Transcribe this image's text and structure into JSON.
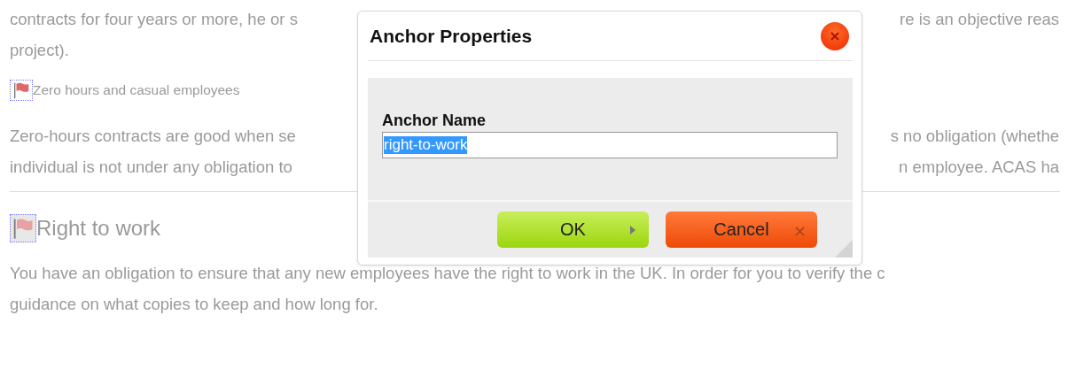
{
  "document": {
    "lines": [
      {
        "kind": "text",
        "left": "contracts for four years or more, he or s",
        "right": "re is an objective reas"
      },
      {
        "kind": "text",
        "left": "project)."
      },
      {
        "kind": "anchor",
        "left": "Zero hours and casual employees"
      },
      {
        "kind": "text",
        "left": "Zero-hours contracts are good when se",
        "right": "s no obligation (whethe"
      },
      {
        "kind": "text",
        "left": "individual is not under any obligation to",
        "right": "n employee. ACAS ha"
      },
      {
        "kind": "rule"
      },
      {
        "kind": "anchor-heading",
        "left": "Right to work"
      },
      {
        "kind": "text",
        "left": "You have an obligation to ensure that any new employees have the right to work in the UK. In order for you to verify the c"
      },
      {
        "kind": "text",
        "left": "guidance on what copies to keep and how long for."
      }
    ]
  },
  "dialog": {
    "title": "Anchor Properties",
    "field": {
      "label": "Anchor Name",
      "value": "right-to-work",
      "text_selected": true
    },
    "buttons": [
      {
        "kind": "ok",
        "label": "OK"
      },
      {
        "kind": "cancel",
        "label": "Cancel"
      }
    ]
  }
}
